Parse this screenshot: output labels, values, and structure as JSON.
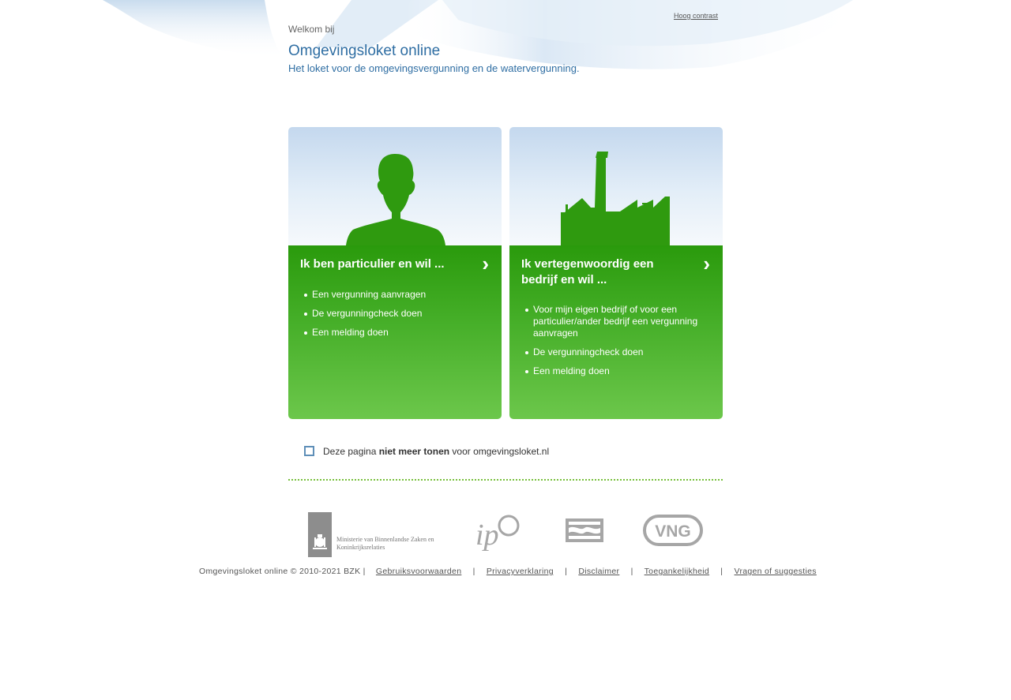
{
  "header": {
    "high_contrast_link": "Hoog contrast",
    "welcome": "Welkom bij",
    "title": "Omgevingsloket online",
    "subtitle": "Het loket voor de omgevingsvergunning en de watervergunning."
  },
  "cards": [
    {
      "heading": "Ik ben particulier en wil ...",
      "chevron": "›",
      "items": [
        "Een vergunning aanvragen",
        "De vergunningcheck doen",
        "Een melding doen"
      ]
    },
    {
      "heading": "Ik vertegenwoordig een bedrijf en wil ...",
      "chevron": "›",
      "items": [
        "Voor mijn eigen bedrijf of voor een particulier/ander bedrijf een vergunning aanvragen",
        "De vergunningcheck doen",
        "Een melding doen"
      ]
    }
  ],
  "preference": {
    "pre": "Deze pagina ",
    "bold": "niet meer tonen",
    "post": " voor omgevingsloket.nl",
    "checked": false
  },
  "logos": {
    "ministry_line1": "Ministerie van Binnenlandse Zaken en",
    "ministry_line2": "Koninkrijksrelaties",
    "ipo": "ip",
    "vng": "VNG"
  },
  "footer": {
    "copyright": "Omgevingsloket online © 2010-2021 BZK |",
    "links": [
      "Gebruiksvoorwaarden",
      "Privacyverklaring",
      "Disclaimer",
      "Toegankelijkheid",
      "Vragen of suggesties"
    ],
    "separator": "|"
  },
  "colors": {
    "accent_blue": "#2f6ea3",
    "card_green": "#3aa61a",
    "silhouette_green": "#2f9a0f",
    "divider_green": "#78c03c"
  }
}
